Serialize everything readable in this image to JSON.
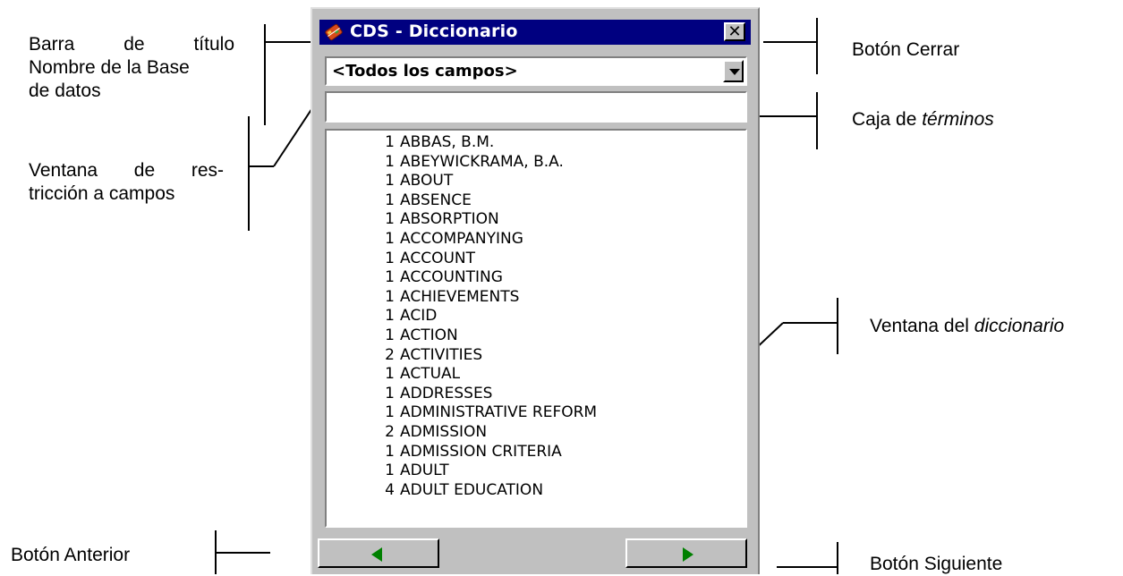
{
  "dialog": {
    "title": "CDS - Diccionario",
    "close_label": "✕",
    "field_select_value": "<Todos los campos>",
    "terms_value": "",
    "dictionary": [
      {
        "count": "1",
        "term": "ABBAS, B.M."
      },
      {
        "count": "1",
        "term": "ABEYWICKRAMA, B.A."
      },
      {
        "count": "1",
        "term": "ABOUT"
      },
      {
        "count": "1",
        "term": "ABSENCE"
      },
      {
        "count": "1",
        "term": "ABSORPTION"
      },
      {
        "count": "1",
        "term": "ACCOMPANYING"
      },
      {
        "count": "1",
        "term": "ACCOUNT"
      },
      {
        "count": "1",
        "term": "ACCOUNTING"
      },
      {
        "count": "1",
        "term": "ACHIEVEMENTS"
      },
      {
        "count": "1",
        "term": "ACID"
      },
      {
        "count": "1",
        "term": "ACTION"
      },
      {
        "count": "2",
        "term": "ACTIVITIES"
      },
      {
        "count": "1",
        "term": "ACTUAL"
      },
      {
        "count": "1",
        "term": "ADDRESSES"
      },
      {
        "count": "1",
        "term": "ADMINISTRATIVE REFORM"
      },
      {
        "count": "2",
        "term": "ADMISSION"
      },
      {
        "count": "1",
        "term": "ADMISSION CRITERIA"
      },
      {
        "count": "1",
        "term": "ADULT"
      },
      {
        "count": "4",
        "term": "ADULT EDUCATION"
      }
    ],
    "nav_arrow_color": "#008000",
    "titlebar_color": "#000080"
  },
  "annotations": {
    "title_bar": [
      "Barra de título",
      "Nombre de la Base",
      "de datos"
    ],
    "field_restriction": [
      "Ventana de res-",
      "tricción a campos"
    ],
    "previous_button": "Botón Anterior",
    "close_button": "Botón Cerrar",
    "terms_box_prefix": "Caja de ",
    "terms_box_em": "términos",
    "dictionary_window_prefix": "Ventana del ",
    "dictionary_window_em": "diccionario",
    "next_button": "Botón Siguiente"
  }
}
